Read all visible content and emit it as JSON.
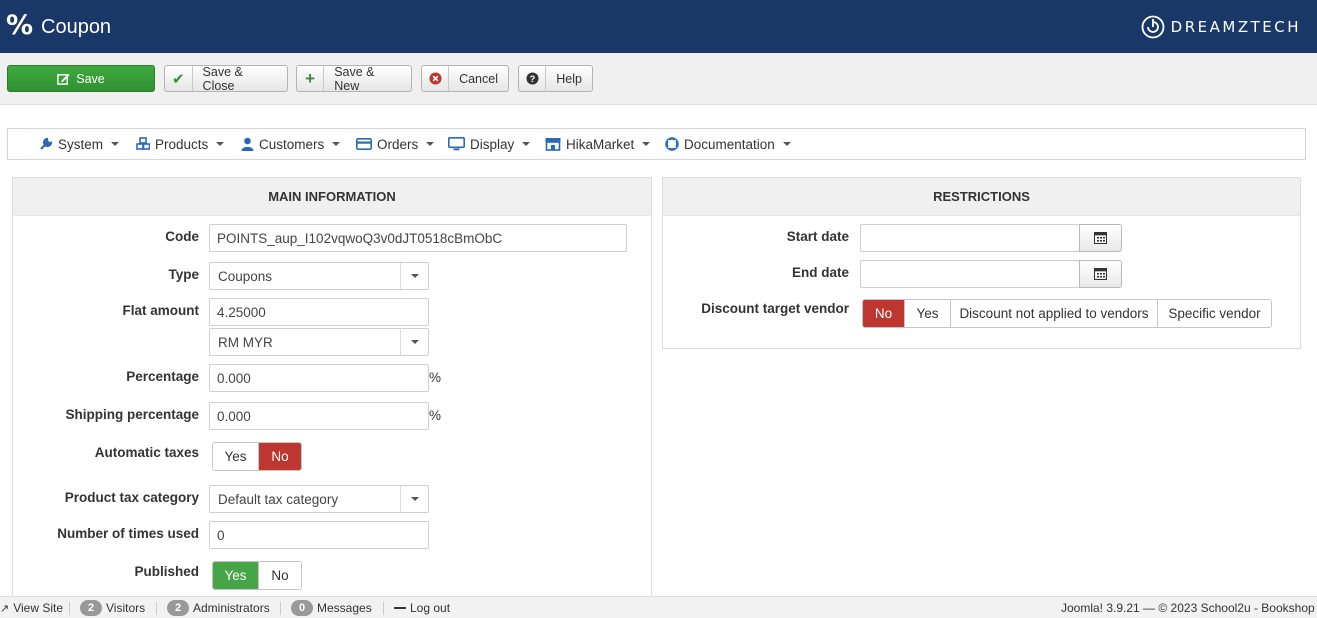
{
  "header": {
    "page_icon": "%",
    "title": "Coupon",
    "brand": "DREAMZTECH"
  },
  "toolbar": {
    "save_label": "Save",
    "save_close_label": "Save & Close",
    "save_new_label": "Save & New",
    "cancel_label": "Cancel",
    "help_label": "Help"
  },
  "menu": {
    "items": [
      {
        "label": "System",
        "icon": "wrench-icon"
      },
      {
        "label": "Products",
        "icon": "cubes-icon"
      },
      {
        "label": "Customers",
        "icon": "user-icon"
      },
      {
        "label": "Orders",
        "icon": "credit-card-icon"
      },
      {
        "label": "Display",
        "icon": "monitor-icon"
      },
      {
        "label": "HikaMarket",
        "icon": "store-icon"
      },
      {
        "label": "Documentation",
        "icon": "life-ring-icon"
      }
    ]
  },
  "main_info": {
    "title": "MAIN INFORMATION",
    "code_label": "Code",
    "code_value": "POINTS_aup_I102vqwoQ3v0dJT0518cBmObC",
    "type_label": "Type",
    "type_value": "Coupons",
    "flat_amount_label": "Flat amount",
    "flat_amount_value": "4.25000",
    "currency_value": "RM MYR",
    "percentage_label": "Percentage",
    "percentage_value": "0.000",
    "percent_suffix": "%",
    "shipping_percentage_label": "Shipping percentage",
    "shipping_percentage_value": "0.000",
    "shipping_percent_suffix": "%",
    "automatic_taxes_label": "Automatic taxes",
    "automatic_taxes_yes": "Yes",
    "automatic_taxes_no": "No",
    "automatic_taxes_selected": "No",
    "product_tax_label": "Product tax category",
    "product_tax_value": "Default tax category",
    "times_used_label": "Number of times used",
    "times_used_value": "0",
    "published_label": "Published",
    "published_yes": "Yes",
    "published_no": "No",
    "published_selected": "Yes"
  },
  "restrictions": {
    "title": "RESTRICTIONS",
    "start_date_label": "Start date",
    "start_date_value": "",
    "end_date_label": "End date",
    "end_date_value": "",
    "vendor_label": "Discount target vendor",
    "vendor_options": [
      "No",
      "Yes",
      "Discount not applied to vendors",
      "Specific vendor"
    ],
    "vendor_selected": "No"
  },
  "statusbar": {
    "view_site": "View Site",
    "visitors_count": "2",
    "visitors_label": "Visitors",
    "admins_count": "2",
    "admins_label": "Administrators",
    "messages_count": "0",
    "messages_label": "Messages",
    "logout_label": "Log out",
    "footer_text": "Joomla! 3.9.21 — © 2023 School2u - Bookshop"
  },
  "colors": {
    "header_bg": "#1a3867",
    "save_green": "#3fa93f",
    "active_red": "#bd362f",
    "active_green": "#46a546",
    "menu_icon_blue": "#2a6ab4"
  }
}
